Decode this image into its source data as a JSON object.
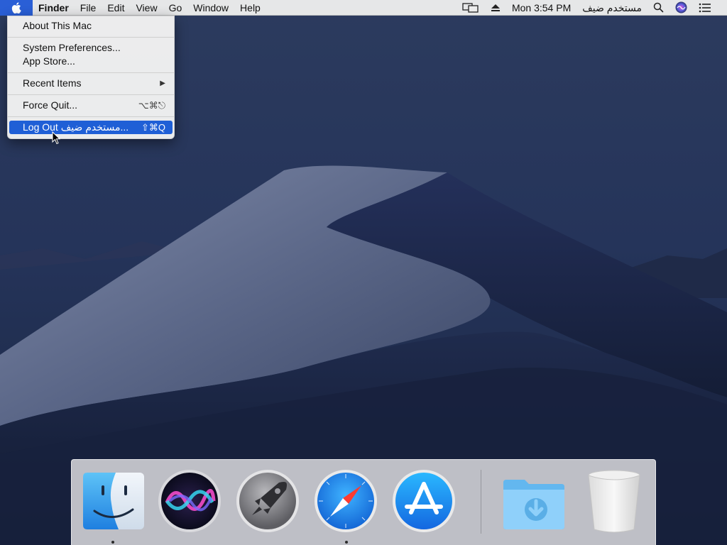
{
  "menubar": {
    "app_name": "Finder",
    "menus": [
      "File",
      "Edit",
      "View",
      "Go",
      "Window",
      "Help"
    ],
    "clock": "Mon 3:54 PM",
    "username": "مستخدم ضيف",
    "status_icons": [
      "display-mirror-icon",
      "eject-icon",
      "search-icon",
      "siri-icon",
      "notification-center-icon"
    ]
  },
  "apple_menu": {
    "about": "About This Mac",
    "system_preferences": "System Preferences...",
    "app_store": "App Store...",
    "recent_items": "Recent Items",
    "force_quit": "Force Quit...",
    "force_quit_shortcut": "⌥⌘⎋",
    "log_out": "Log Out مستخدم ضيف...",
    "log_out_shortcut": "⇧⌘Q"
  },
  "dock": {
    "apps": [
      {
        "name": "Finder",
        "icon": "finder-icon",
        "running": true
      },
      {
        "name": "Siri",
        "icon": "siri-icon",
        "running": false
      },
      {
        "name": "Launchpad",
        "icon": "launchpad-icon",
        "running": false
      },
      {
        "name": "Safari",
        "icon": "safari-icon",
        "running": true
      },
      {
        "name": "App Store",
        "icon": "app-store-icon",
        "running": false
      },
      {
        "name": "Downloads",
        "icon": "downloads-folder-icon",
        "running": false
      },
      {
        "name": "Trash",
        "icon": "trash-icon",
        "running": false
      }
    ]
  },
  "colors": {
    "highlight": "#1f5fd6",
    "sky_top": "#2a3a5c",
    "sky_bottom": "#15203a"
  }
}
